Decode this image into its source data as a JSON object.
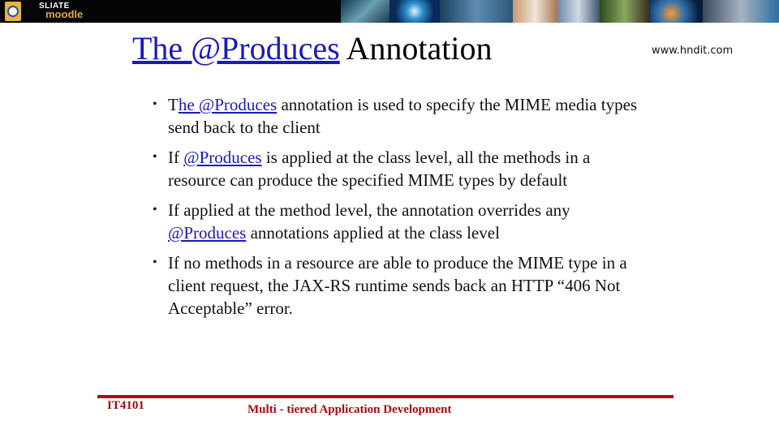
{
  "banner": {
    "logo_icon": "institute-crest-icon",
    "brand_top": "SLIATE",
    "brand_bottom": "moodle",
    "image_strip": "technology-collage-banner"
  },
  "site_url": "www.hndit.com",
  "title": {
    "link_text": "The @Produces",
    "rest": " Annotation"
  },
  "bullets": [
    {
      "prefix": "T",
      "link": "he @Produces",
      "text": " annotation is used to specify the MIME media types send back to the client"
    },
    {
      "prefix": "If ",
      "link": "@Produces",
      "text": " is applied at the class level, all the methods in a resource can produce the specified MIME types by default"
    },
    {
      "prefix": "If applied at the method level, the annotation overrides any ",
      "link": "@Produces",
      "text": " annotations applied at the class level"
    },
    {
      "prefix": "If no methods in a resource are able to produce the MIME type in a client request, the JAX-RS runtime sends back an HTTP “406 Not Acceptable” error.",
      "link": "",
      "text": ""
    }
  ],
  "bullet_glyph": "•",
  "footer": {
    "course_code": "IT4101",
    "course_name": "Multi - tiered Application Development"
  },
  "colors": {
    "link": "#1a1ab8",
    "footer_accent": "#b40d0d",
    "banner_bg": "#050505",
    "brand_orange": "#e3a435"
  }
}
